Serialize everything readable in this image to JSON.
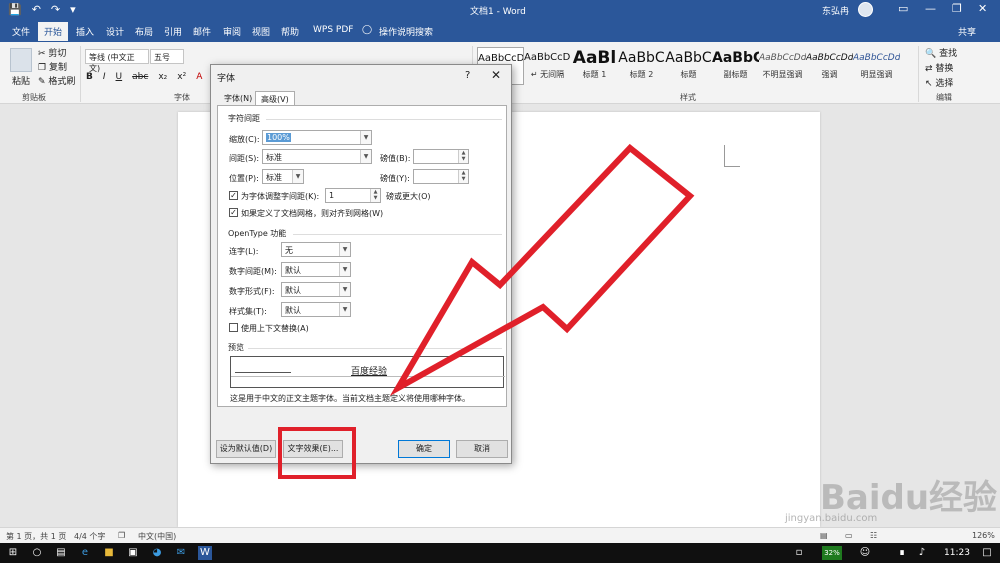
{
  "titlebar": {
    "doc_title": "文档1 - Word",
    "user": "东弘冉",
    "qat_icons": [
      "save-icon",
      "undo-icon",
      "redo-icon",
      "customize-icon"
    ]
  },
  "tabs": [
    "文件",
    "开始",
    "插入",
    "设计",
    "布局",
    "引用",
    "邮件",
    "审阅",
    "视图",
    "帮助",
    "WPS PDF",
    "操作说明搜索"
  ],
  "share_label": "共享",
  "ribbon": {
    "clipboard": {
      "paste": "粘贴",
      "cut": "剪切",
      "copy": "复制",
      "format_painter": "格式刷",
      "group": "剪贴板"
    },
    "font": {
      "name": "等线 (中文正文)",
      "size": "五号",
      "group": "字体",
      "buttons": [
        "B",
        "I",
        "U",
        "abc",
        "x₂",
        "x²",
        "A"
      ]
    },
    "styles": {
      "group": "样式",
      "items": [
        {
          "sample": "AaBbCcDd",
          "name": "正文"
        },
        {
          "sample": "AaBbCcDd",
          "name": "↵ 无间隔"
        },
        {
          "sample": "AaBl",
          "name": "标题 1"
        },
        {
          "sample": "AaBbC",
          "name": "标题 2"
        },
        {
          "sample": "AaBbC",
          "name": "标题"
        },
        {
          "sample": "AaBbC",
          "name": "副标题"
        },
        {
          "sample": "AaBbCcDd",
          "name": "不明显强调"
        },
        {
          "sample": "AaBbCcDd",
          "name": "强调"
        },
        {
          "sample": "AaBbCcDd",
          "name": "明显强调"
        }
      ]
    },
    "editing": {
      "find": "查找",
      "replace": "替换",
      "select": "选择",
      "group": "编辑"
    }
  },
  "dialog": {
    "title": "字体",
    "help": "?",
    "tabs": [
      "字体(N)",
      "高级(V)"
    ],
    "spacing_section": "字符间距",
    "scale_label": "缩放(C):",
    "scale_value": "100%",
    "spacing_label": "间距(S):",
    "spacing_value": "标准",
    "spacing_by_label": "磅值(B):",
    "position_label": "位置(P):",
    "position_value": "标准",
    "position_by_label": "磅值(Y):",
    "kerning_label": "为字体调整字间距(K):",
    "kerning_value": "1",
    "kerning_suffix": "磅或更大(O)",
    "grid_label": "如果定义了文档网格，则对齐到网格(W)",
    "opentype_section": "OpenType 功能",
    "ligatures_label": "连字(L):",
    "ligatures_value": "无",
    "num_spacing_label": "数字间距(M):",
    "num_spacing_value": "默认",
    "num_forms_label": "数字形式(F):",
    "num_forms_value": "默认",
    "stylistic_label": "样式集(T):",
    "stylistic_value": "默认",
    "contextual_label": "使用上下文替换(A)",
    "preview_section": "预览",
    "preview_text": "百度经验",
    "preview_note": "这是用于中文的正文主题字体。当前文档主题定义将使用哪种字体。",
    "btn_default": "设为默认值(D)",
    "btn_effects": "文字效果(E)...",
    "btn_ok": "确定",
    "btn_cancel": "取消"
  },
  "statusbar": {
    "page": "第 1 页，共 1 页",
    "words": "4/4 个字",
    "lang": "中文(中国)",
    "zoom": "126%"
  },
  "taskbar": {
    "battery": "32%",
    "time": "11:23"
  },
  "watermark": {
    "text": "Baidu经验",
    "url": "jingyan.baidu.com"
  },
  "colors": {
    "accent": "#2b579a",
    "annotation": "#e0202a"
  }
}
